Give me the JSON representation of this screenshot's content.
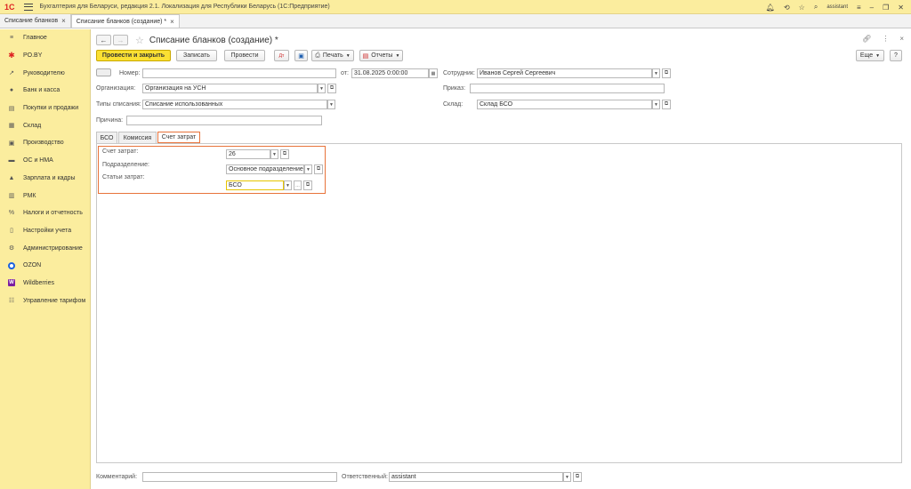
{
  "titlebar": {
    "logo_text": "1С",
    "title": "Бухгалтерия для Беларуси, редакция 2.1. Локализация для Республики Беларусь   (1С:Предприятие)",
    "user": "assistant"
  },
  "tabs": [
    {
      "label": "Списание бланков"
    },
    {
      "label": "Списание бланков (создание) *"
    }
  ],
  "sidebar": {
    "items": [
      {
        "label": "Главное",
        "icon": "menu-lines-icon"
      },
      {
        "label": "PO.BY",
        "icon": "sun-icon"
      },
      {
        "label": "Руководителю",
        "icon": "trend-icon"
      },
      {
        "label": "Банк и касса",
        "icon": "coin-icon"
      },
      {
        "label": "Покупки и продажи",
        "icon": "cart-icon"
      },
      {
        "label": "Склад",
        "icon": "warehouse-icon"
      },
      {
        "label": "Производство",
        "icon": "factory-icon"
      },
      {
        "label": "ОС и НМА",
        "icon": "truck-icon"
      },
      {
        "label": "Зарплата и кадры",
        "icon": "person-icon"
      },
      {
        "label": "РМК",
        "icon": "register-icon"
      },
      {
        "label": "Налоги и отчетность",
        "icon": "percent-icon"
      },
      {
        "label": "Настройки учета",
        "icon": "document-icon"
      },
      {
        "label": "Администрирование",
        "icon": "gear-icon"
      },
      {
        "label": "OZON",
        "icon": "ozon-icon"
      },
      {
        "label": "Wildberries",
        "icon": "wildberries-icon"
      },
      {
        "label": "Управление тарифом",
        "icon": "tiles-icon"
      }
    ]
  },
  "form": {
    "title": "Списание бланков (создание) *",
    "toolbar": {
      "post_close": "Провести и закрыть",
      "save": "Записать",
      "post": "Провести",
      "print": "Печать",
      "reports": "Отчеты",
      "more": "Еще",
      "help": "?"
    },
    "number_label": "Номер:",
    "number_value": "",
    "date_label": "от:",
    "date_value": "31.08.2025  0:00:00",
    "employee_label": "Сотрудник:",
    "employee_value": "Иванов Сергей Сергеевич",
    "org_label": "Организация:",
    "org_value": "Организация на УСН",
    "order_label": "Приказ:",
    "order_value": "",
    "type_label": "Типы списания:",
    "type_value": "Списание использованных",
    "warehouse_label": "Склад:",
    "warehouse_value": "Склад БСО",
    "reason_label": "Причина:",
    "reason_value": "",
    "tabs": [
      {
        "label": "БСО"
      },
      {
        "label": "Комиссия"
      },
      {
        "label": "Счет затрат"
      }
    ],
    "cost": {
      "account_label": "Счет затрат:",
      "account_value": "26",
      "division_label": "Подразделение:",
      "division_value": "Основное подразделение",
      "item_label": "Статьи затрат:",
      "item_value": "БСО"
    },
    "comment_label": "Комментарий:",
    "comment_value": "",
    "responsible_label": "Ответственный:",
    "responsible_value": "assistant"
  },
  "colors": {
    "accent_yellow": "#fbed9e",
    "primary_button": "#fbe033",
    "highlight": "#e8733a"
  }
}
